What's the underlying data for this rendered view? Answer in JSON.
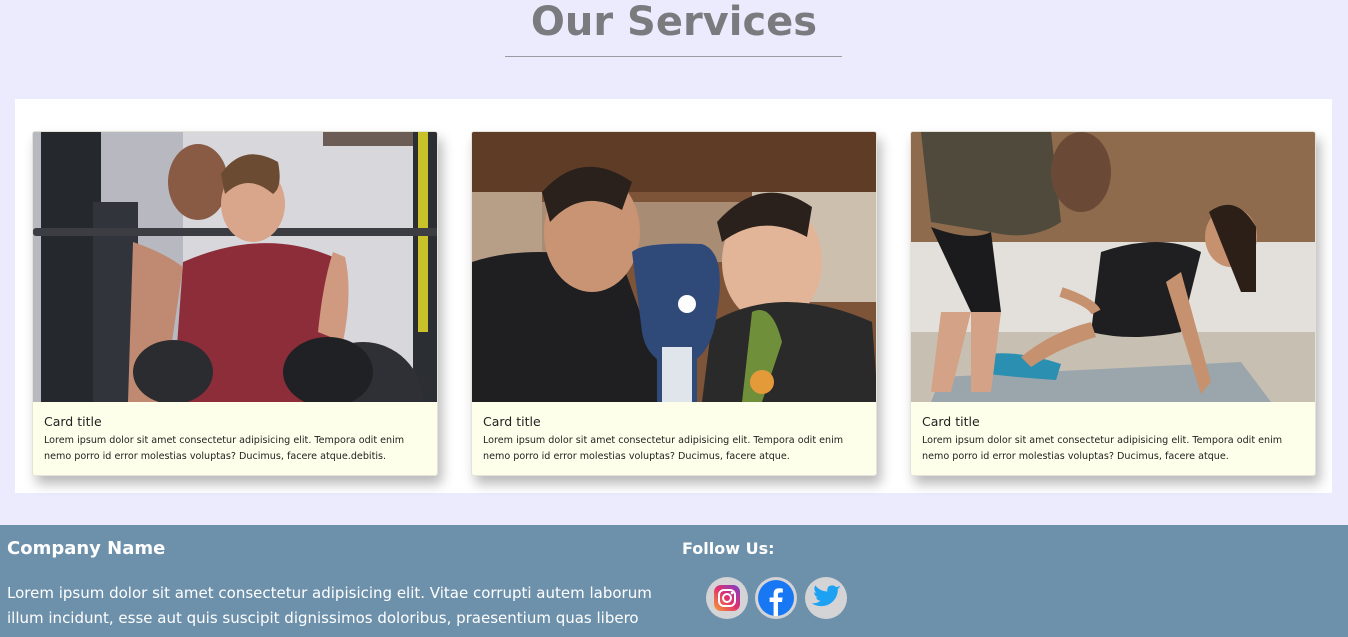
{
  "section": {
    "heading": "Our Services"
  },
  "cards": [
    {
      "title": "Card title",
      "text": "Lorem ipsum dolor sit amet consectetur adipisicing elit. Tempora odit enim nemo porro id error molestias voluptas? Ducimus, facere atque.debitis."
    },
    {
      "title": "Card title",
      "text": "Lorem ipsum dolor sit amet consectetur adipisicing elit. Tempora odit enim nemo porro id error molestias voluptas? Ducimus, facere atque."
    },
    {
      "title": "Card title",
      "text": "Lorem ipsum dolor sit amet consectetur adipisicing elit. Tempora odit enim nemo porro id error molestias voluptas? Ducimus, facere atque."
    }
  ],
  "footer": {
    "company_name": "Company Name",
    "company_text": "Lorem ipsum dolor sit amet consectetur adipisicing elit. Vitae corrupti autem laborum illum incidunt, esse aut quis suscipit dignissimos doloribus, praesentium quas libero",
    "follow_label": "Follow Us:",
    "social": [
      {
        "name": "instagram-icon"
      },
      {
        "name": "facebook-icon"
      },
      {
        "name": "twitter-icon"
      }
    ]
  },
  "colors": {
    "page_bg": "#ECEBFE",
    "card_bg": "#FEFFEA",
    "footer_bg": "#6E91AB",
    "heading": "#7B7B7F"
  }
}
